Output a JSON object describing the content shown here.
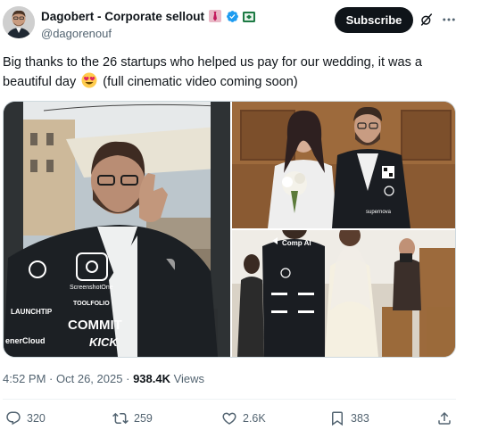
{
  "author": {
    "display_name": "Dagobert - Corporate sellout",
    "handle": "@dagorenouf",
    "badges": [
      "necktie-emoji",
      "verified-badge-icon",
      "flag-icon"
    ]
  },
  "header": {
    "subscribe_label": "Subscribe",
    "grok_icon": "grok-icon",
    "more_icon": "more-icon"
  },
  "post": {
    "text_part1": "Big thanks to the 26 startups who helped us pay for our wedding, it was a beautiful day",
    "emoji": "smiling-face-with-heart-eyes",
    "text_part2": "(full cinematic video coming soon)"
  },
  "media": {
    "photo1": {
      "jacket_logos": [
        "LAUNCHTIP",
        "ScreenshotOne",
        "TOOLFOLIO",
        "COMMIT",
        "KICK",
        "enerCloud"
      ]
    },
    "photo2": {
      "jacket_logos": [
        "supernova"
      ]
    },
    "photo3": {
      "jacket_logos": [
        "Comp AI"
      ]
    }
  },
  "meta": {
    "time": "4:52 PM",
    "separator": "·",
    "date": "Oct 26, 2025",
    "views_count": "938.4K",
    "views_label": "Views"
  },
  "actions": {
    "replies": "320",
    "reposts": "259",
    "likes": "2.6K",
    "bookmarks": "383"
  },
  "colors": {
    "text": "#0f1419",
    "secondary": "#536471",
    "verified": "#1d9bf0",
    "button_bg": "#0f1419",
    "divider": "#eff3f4"
  }
}
